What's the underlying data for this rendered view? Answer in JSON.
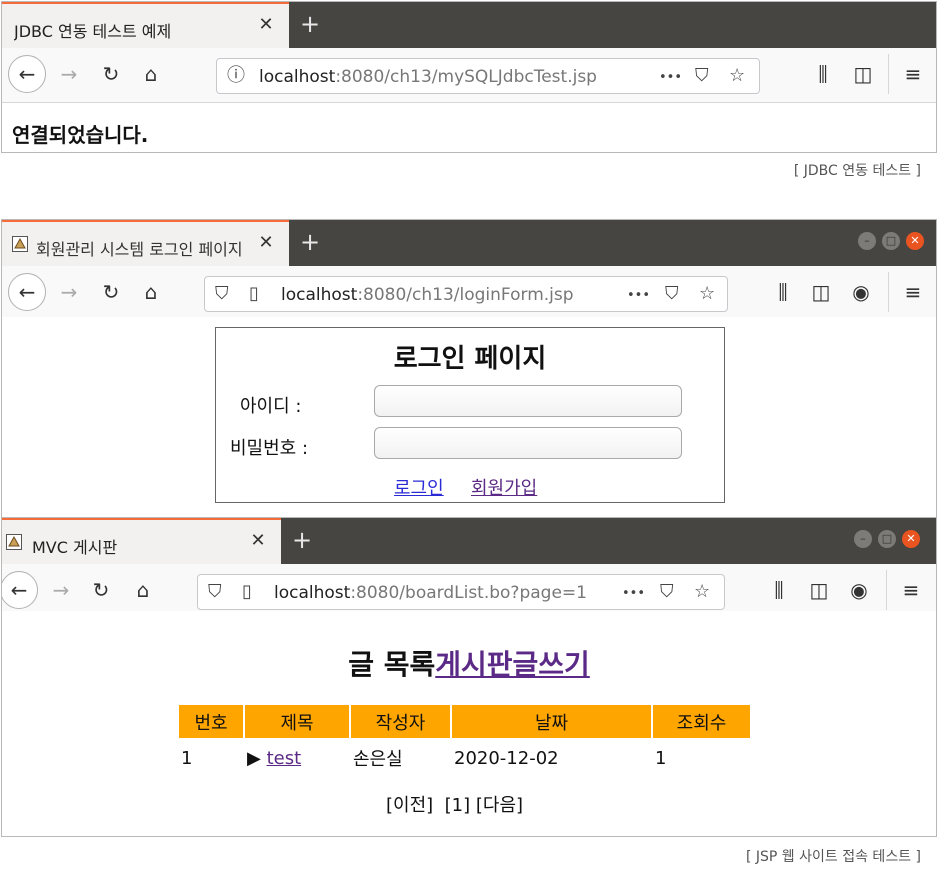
{
  "window1": {
    "tab_title": "JDBC 연동 테스트 예제",
    "url_host": "localhost",
    "url_path": ":8080/ch13/mySQLJdbcTest.jsp",
    "message": "연결되었습니다.",
    "caption": "[ JDBC 연동 테스트 ]"
  },
  "window2": {
    "tab_title": "회원관리 시스템 로그인 페이지",
    "url_host": "localhost",
    "url_path": ":8080/ch13/loginForm.jsp",
    "heading": "로그인 페이지",
    "id_label": "아이디 :",
    "password_label": "비밀번호 :",
    "login_link": "로그인",
    "join_link": "회원가입"
  },
  "window3": {
    "tab_title": "MVC 게시판",
    "url_host": "localhost",
    "url_path": ":8080/boardList.bo?page=1",
    "heading_text": "글 목록",
    "heading_link": "게시판글쓰기",
    "columns": [
      "번호",
      "제목",
      "작성자",
      "날짜",
      "조회수"
    ],
    "rows": [
      {
        "num": "1",
        "marker": "▶",
        "title": "test",
        "author": "손은실",
        "date": "2020-12-02",
        "views": "1"
      }
    ],
    "pagination": {
      "prev": "[이전]",
      "page": "[1]",
      "next": "[다음]"
    },
    "caption": "[ JSP 웹 사이트 접속 테스트 ]"
  },
  "icons": {
    "back": "←",
    "forward": "→",
    "reload": "↻",
    "home": "⌂",
    "new_tab": "+",
    "close": "✕",
    "menu": "≡",
    "more": "•••",
    "pocket": "⛉",
    "star": "☆",
    "library": "⫼",
    "sidebar": "◫",
    "account": "◉",
    "info": "ⓘ",
    "shield": "⛉",
    "page": "▯"
  }
}
